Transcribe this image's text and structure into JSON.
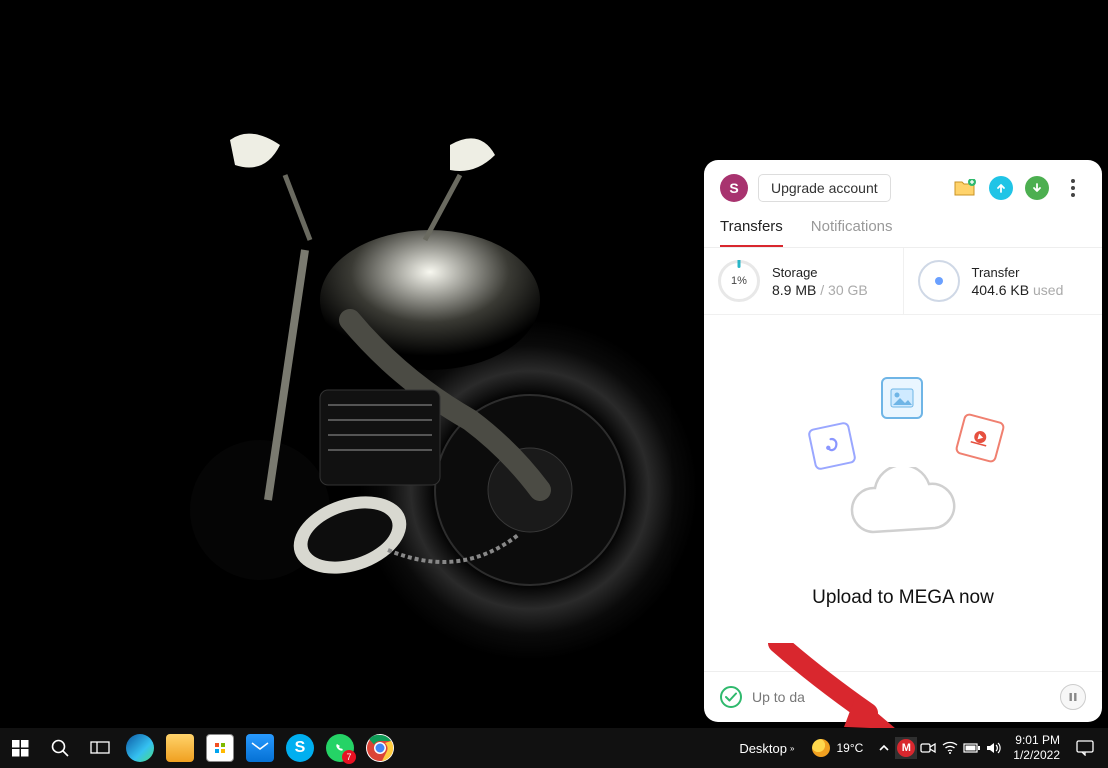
{
  "mega": {
    "avatar_letter": "S",
    "upgrade_label": "Upgrade account",
    "tabs": {
      "transfers": "Transfers",
      "notifications": "Notifications"
    },
    "storage": {
      "label": "Storage",
      "percent": "1%",
      "used": "8.9 MB",
      "sep": " / ",
      "total": "30 GB"
    },
    "transfer": {
      "label": "Transfer",
      "amount": "404.6 KB",
      "suffix": " used"
    },
    "cta": "Upload to MEGA now",
    "footer_status": "Up to da"
  },
  "taskbar": {
    "desktop_label": "Desktop",
    "temperature": "19°C",
    "whatsapp_badge": "7",
    "mega_letter": "M",
    "time": "9:01 PM",
    "date": "1/2/2022"
  }
}
